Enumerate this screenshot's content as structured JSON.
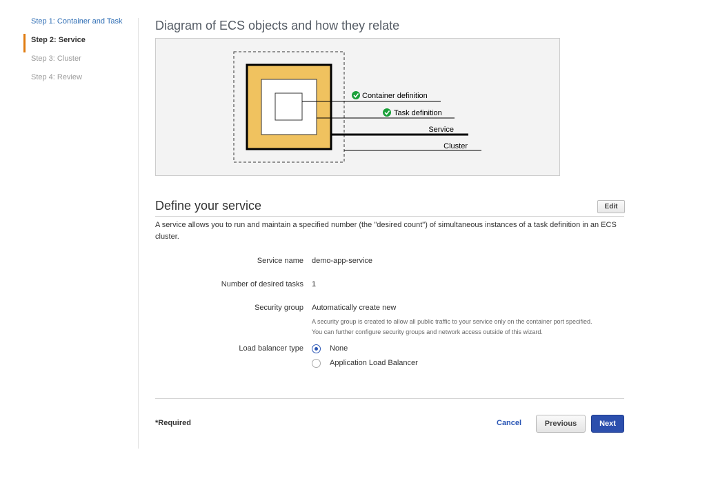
{
  "sidebar": {
    "steps": [
      {
        "label": "Step 1: Container and Task",
        "state": "done"
      },
      {
        "label": "Step 2: Service",
        "state": "active"
      },
      {
        "label": "Step 3: Cluster",
        "state": "future"
      },
      {
        "label": "Step 4: Review",
        "state": "future"
      }
    ]
  },
  "diagram": {
    "title": "Diagram of ECS objects and how they relate",
    "labels": {
      "container": "Container definition",
      "task": "Task definition",
      "service": "Service",
      "cluster": "Cluster"
    },
    "colors": {
      "service_fill": "#f0c25f",
      "check": "#1aa039"
    }
  },
  "service": {
    "title": "Define your service",
    "edit_label": "Edit",
    "description": "A service allows you to run and maintain a specified number (the \"desired count\") of simultaneous instances of a task definition in an ECS cluster.",
    "fields": {
      "name_label": "Service name",
      "name_value": "demo-app-service",
      "tasks_label": "Number of desired tasks",
      "tasks_value": "1",
      "sg_label": "Security group",
      "sg_value": "Automatically create new",
      "sg_help_1": "A security group is created to allow all public traffic to your service only on the container port specified.",
      "sg_help_2": "You can further configure security groups and network access outside of this wizard.",
      "lb_label": "Load balancer type"
    },
    "lb_options": [
      {
        "label": "None",
        "checked": true
      },
      {
        "label": "Application Load Balancer",
        "checked": false
      }
    ]
  },
  "footer": {
    "required": "*Required",
    "cancel": "Cancel",
    "previous": "Previous",
    "next": "Next"
  }
}
